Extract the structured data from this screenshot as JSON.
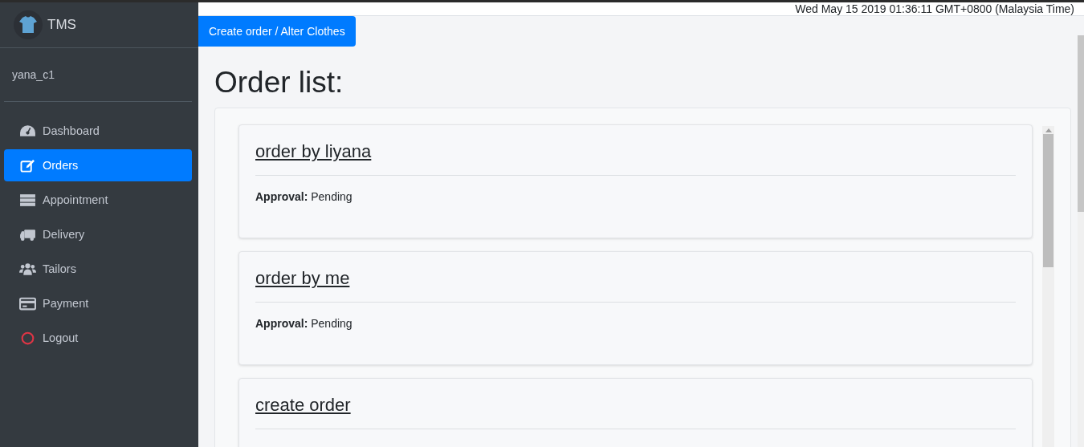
{
  "brand": {
    "name": "TMS"
  },
  "user": {
    "name": "yana_c1"
  },
  "nav": [
    {
      "label": "Dashboard",
      "selected": false
    },
    {
      "label": "Orders",
      "selected": true
    },
    {
      "label": "Appointment",
      "selected": false
    },
    {
      "label": "Delivery",
      "selected": false
    },
    {
      "label": "Tailors",
      "selected": false
    },
    {
      "label": "Payment",
      "selected": false
    },
    {
      "label": "Logout",
      "selected": false
    }
  ],
  "header": {
    "datetime": "Wed May 15 2019 01:36:11 GMT+0800 (Malaysia Time)"
  },
  "create_button": {
    "label": "Create order / Alter Clothes"
  },
  "page_title": "Order list:",
  "orders": [
    {
      "title": "order by liyana",
      "approval_label": "Approval:",
      "approval": "Pending"
    },
    {
      "title": "order by me",
      "approval_label": "Approval:",
      "approval": "Pending"
    },
    {
      "title": "create order"
    }
  ]
}
